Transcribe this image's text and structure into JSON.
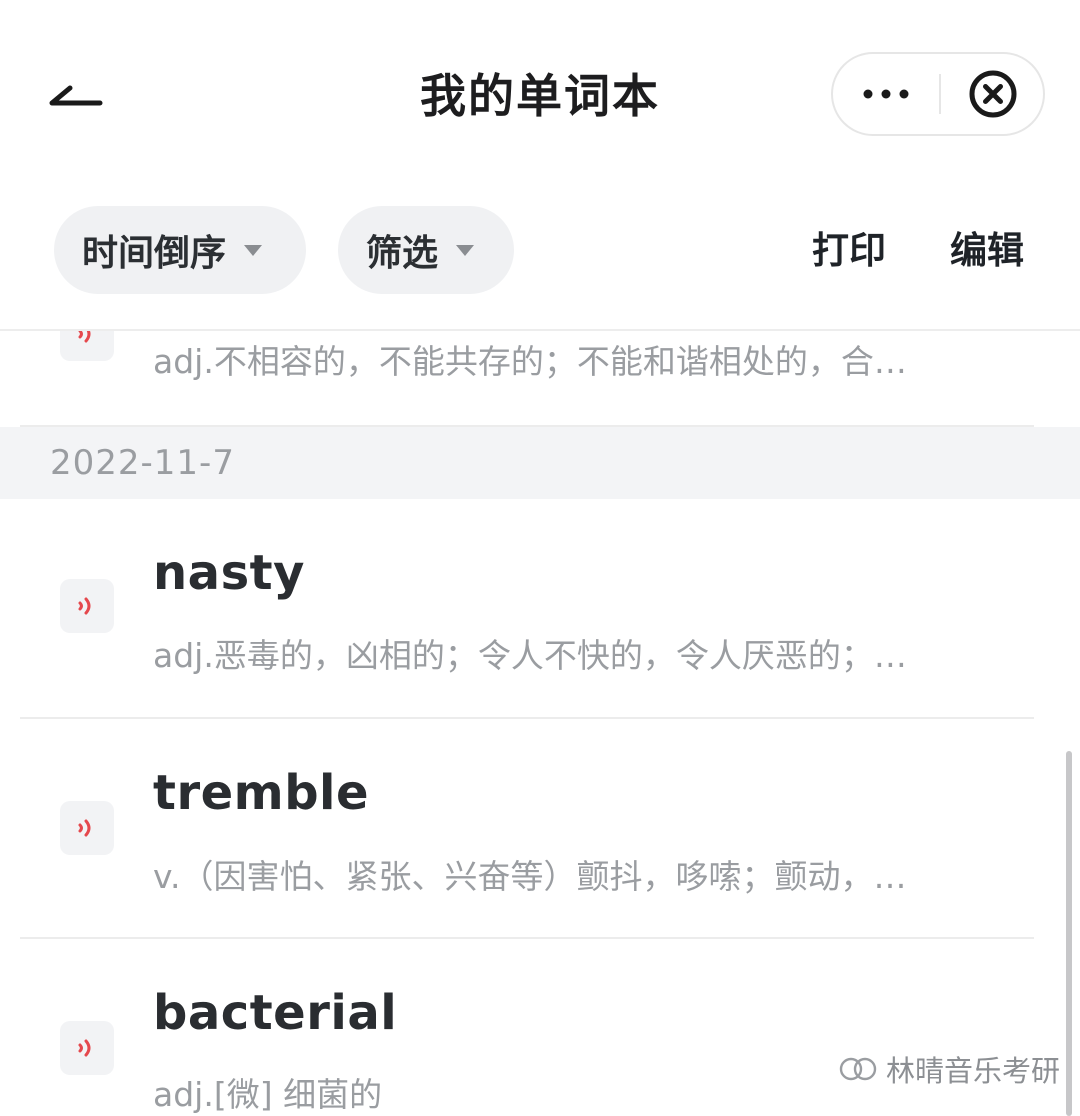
{
  "header": {
    "title": "我的单词本",
    "back_icon": "back-arrow-icon",
    "more_icon": "more-dots-icon",
    "close_icon": "close-circle-icon"
  },
  "toolbar": {
    "sort_label": "时间倒序",
    "filter_label": "筛选",
    "print_label": "打印",
    "edit_label": "编辑"
  },
  "list": {
    "partial_item": {
      "definition": "adj.不相容的，不能共存的；不能和谐相处的，合…"
    },
    "groups": [
      {
        "date": "2022-11-7",
        "items": [
          {
            "word": "nasty",
            "definition": "adj.恶毒的，凶相的；令人不快的，令人厌恶的；…"
          },
          {
            "word": "tremble",
            "definition": "v.（因害怕、紧张、兴奋等）颤抖，哆嗦；颤动，…"
          },
          {
            "word": "bacterial",
            "definition": "adj.[微] 细菌的"
          }
        ]
      }
    ]
  },
  "watermark": {
    "text": "林晴音乐考研"
  },
  "colors": {
    "accent_red": "#e5484d",
    "date_bg": "#f3f4f6",
    "pill_bg": "#f0f1f3"
  }
}
